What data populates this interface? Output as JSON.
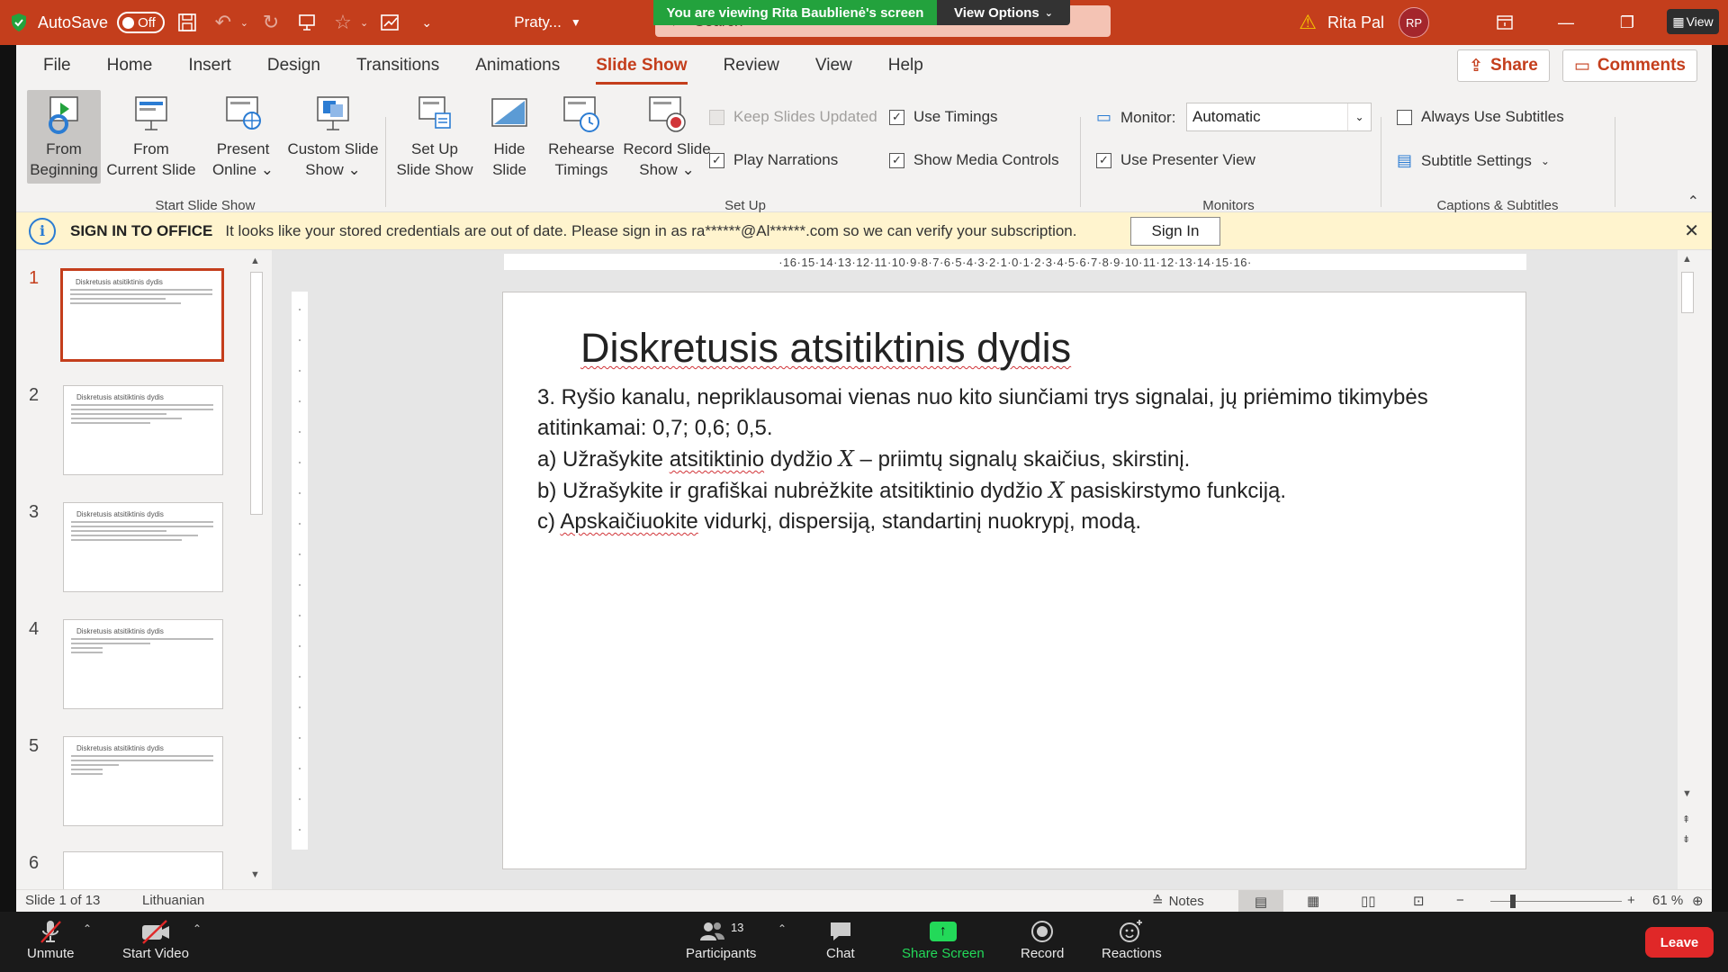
{
  "titlebar": {
    "autosave_label": "AutoSave",
    "autosave_state": "Off",
    "doc_title": "Praty...",
    "search_placeholder": "Search",
    "user_name": "Rita Pal",
    "user_initials": "RP",
    "view_label": "View"
  },
  "screen_share": {
    "banner": "You are viewing Rita Baublienė's screen",
    "view_options": "View Options"
  },
  "tabs": [
    "File",
    "Home",
    "Insert",
    "Design",
    "Transitions",
    "Animations",
    "Slide Show",
    "Review",
    "View",
    "Help"
  ],
  "active_tab": "Slide Show",
  "actions": {
    "share": "Share",
    "comments": "Comments"
  },
  "ribbon": {
    "start_group": "Start Slide Show",
    "setup_group": "Set Up",
    "monitors_group": "Monitors",
    "captions_group": "Captions & Subtitles",
    "from_beginning_1": "From",
    "from_beginning_2": "Beginning",
    "from_current_1": "From",
    "from_current_2": "Current Slide",
    "present_online_1": "Present",
    "present_online_2": "Online",
    "custom_show_1": "Custom Slide",
    "custom_show_2": "Show",
    "setup_show_1": "Set Up",
    "setup_show_2": "Slide Show",
    "hide_slide_1": "Hide",
    "hide_slide_2": "Slide",
    "rehearse_1": "Rehearse",
    "rehearse_2": "Timings",
    "record_1": "Record Slide",
    "record_2": "Show",
    "keep_updated": "Keep Slides Updated",
    "play_narrations": "Play Narrations",
    "use_timings": "Use Timings",
    "show_media_controls": "Show Media Controls",
    "monitor_label": "Monitor:",
    "monitor_value": "Automatic",
    "use_presenter_view": "Use Presenter View",
    "always_subtitles": "Always Use Subtitles",
    "subtitle_settings": "Subtitle Settings"
  },
  "message": {
    "title": "SIGN IN TO OFFICE",
    "text": "It looks like your stored credentials are out of date. Please sign in as ra******@Al******.com so we can verify your subscription.",
    "button": "Sign In"
  },
  "thumbnails": [
    {
      "num": "1",
      "title": "Diskretusis atsitiktinis dydis"
    },
    {
      "num": "2",
      "title": "Diskretusis atsitiktinis dydis"
    },
    {
      "num": "3",
      "title": "Diskretusis atsitiktinis dydis"
    },
    {
      "num": "4",
      "title": "Diskretusis atsitiktinis dydis"
    },
    {
      "num": "5",
      "title": "Diskretusis atsitiktinis dydis"
    },
    {
      "num": "6",
      "title": ""
    }
  ],
  "ruler_h": "·16·15·14·13·12·11·10·9·8·7·6·5·4·3·2·1·0·1·2·3·4·5·6·7·8·9·10·11·12·13·14·15·16·",
  "slide": {
    "title": "Diskretusis atsitiktinis dydis",
    "line1": "3. Ryšio kanalu, nepriklausomai vienas nuo kito siunčiami trys signalai, jų priėmimo tikimybės atitinkamai: 0,7; 0,6; 0,5.",
    "line2_a": "a) Užrašykite ",
    "line2_b": "atsitiktinio",
    "line2_c": " dydžio ",
    "var_x": "X",
    "line2_d": " – priimtų signalų skaičius, skirstinį.",
    "line3_a": "b) Užrašykite ir grafiškai nubrėžkite atsitiktinio dydžio ",
    "line3_b": " pasiskirstymo funkciją.",
    "line4_a": "c) ",
    "line4_b": "Apskaičiuokite",
    "line4_c": " vidurkį, dispersiją, standartinį nuokrypį, modą."
  },
  "status": {
    "slide_info": "Slide 1 of 13",
    "language": "Lithuanian",
    "notes": "Notes",
    "zoom": "61 %"
  },
  "zoom_meeting": {
    "unmute": "Unmute",
    "start_video": "Start Video",
    "participants": "Participants",
    "participants_count": "13",
    "chat": "Chat",
    "share_screen": "Share Screen",
    "record": "Record",
    "reactions": "Reactions",
    "leave": "Leave"
  }
}
